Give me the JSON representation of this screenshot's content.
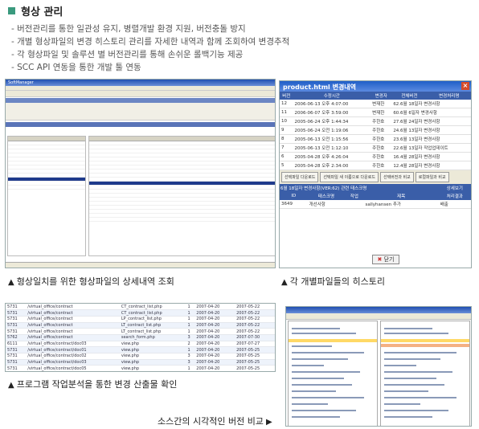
{
  "title": "형상 관리",
  "bullets": [
    "버전관리를 통한 일관성 유지, 병렬개발 환경 지원, 버전충돌 방지",
    "개별 형상파일의 변경 히스토리 관리를 자세한 내역과 함께 조회하여 변경추적",
    "각 형상파일 및 솔루션 별 버전관리를 통해 손쉬운 롤백기능 제공",
    "SCC API 연동을 통한 개발 툴 연동"
  ],
  "captions": {
    "c1": "형상일치를 위한 형상파일의 상세내역 조회",
    "c2": "각 개별파일들의 히스토리",
    "c3": "프로그램 작업분석을 통한 변경 산출물 확인",
    "c4": "소스간의 시각적인 버전 비교"
  },
  "shot1": {
    "window_title": "SoftManager"
  },
  "shot2": {
    "window_title": "product.html 변경내역",
    "columns": [
      "버전",
      "수정시간",
      "변경자",
      "전체버전",
      "변경처리명"
    ],
    "rows": [
      [
        "12",
        "2006-06-13 오후 4:07:00",
        "변재한",
        "62.6월 18일자 변경사항"
      ],
      [
        "11",
        "2006-06-07 오후 3:59:00",
        "변재한",
        "60.6월 6일자 변경사항"
      ],
      [
        "10",
        "2005-06-24 오후 1:44:34",
        "주한호",
        "27.6월 24일자 변경사항"
      ],
      [
        "9",
        "2005-06-24 오전 1:19:06",
        "주한호",
        "24.6월 13일자 변경사항"
      ],
      [
        "8",
        "2005-06-13 오전 1:15:56",
        "주한호",
        "23.6월 13일자 변경사항"
      ],
      [
        "7",
        "2005-06-13 오전 1:12:10",
        "주한호",
        "22.6월 13일자 작업업데이트"
      ],
      [
        "6",
        "2005-04-28 오후 4:26:04",
        "주한호",
        "16.4월 28일자 변경사항"
      ],
      [
        "5",
        "2005-04-28 오후 2:34:00",
        "주한호",
        "12.4월 28일자 변경사항"
      ]
    ],
    "buttons": [
      "선택파일 다운로드",
      "선택파일 새 이름으로 다운로드",
      "선택버전과 비교",
      "로컬파일과 비교"
    ],
    "detail_title": "6월 18일자 변경사항(VER:62) 관련 태스크명",
    "detail_label": "상세보기",
    "detail_columns": [
      "ID",
      "태스크명",
      "작업",
      "제목",
      "처리결과"
    ],
    "detail_row": [
      "3649",
      "개선사항",
      "",
      "sallyhansen 추가",
      "배출"
    ],
    "close_label": "닫기"
  },
  "shot3": {
    "rows": [
      [
        "5731",
        "/virtual_office/contract",
        "CT_contract_list.php",
        "1",
        "2007-04-20",
        "2007-05-22"
      ],
      [
        "5731",
        "/virtual_office/contract",
        "CT_contract_list.php",
        "1",
        "2007-04-20",
        "2007-05-22"
      ],
      [
        "5731",
        "/virtual_office/contract",
        "LP_contract_list.php",
        "1",
        "2007-04-20",
        "2007-05-22"
      ],
      [
        "5731",
        "/virtual_office/contract",
        "LT_contract_list.php",
        "1",
        "2007-04-20",
        "2007-05-22"
      ],
      [
        "5731",
        "/virtual_office/contract",
        "LT_contract_list.php",
        "1",
        "2007-04-20",
        "2007-05-22"
      ],
      [
        "5762",
        "/virtual_office/contract",
        "search_form.php",
        "3",
        "2007-04-20",
        "2007-07-30"
      ],
      [
        "6111",
        "/virtual_office/contract/doc03",
        "view.php",
        "2",
        "2007-04-20",
        "2007-07-27"
      ],
      [
        "5731",
        "/virtual_office/contract/doc01",
        "view.php",
        "1",
        "2007-04-20",
        "2007-05-25"
      ],
      [
        "5731",
        "/virtual_office/contract/doc02",
        "view.php",
        "3",
        "2007-04-20",
        "2007-05-25"
      ],
      [
        "5731",
        "/virtual_office/contract/doc03",
        "view.php",
        "3",
        "2007-04-20",
        "2007-05-25"
      ],
      [
        "5731",
        "/virtual_office/contract/doc05",
        "view.php",
        "1",
        "2007-04-20",
        "2007-05-25"
      ]
    ]
  }
}
